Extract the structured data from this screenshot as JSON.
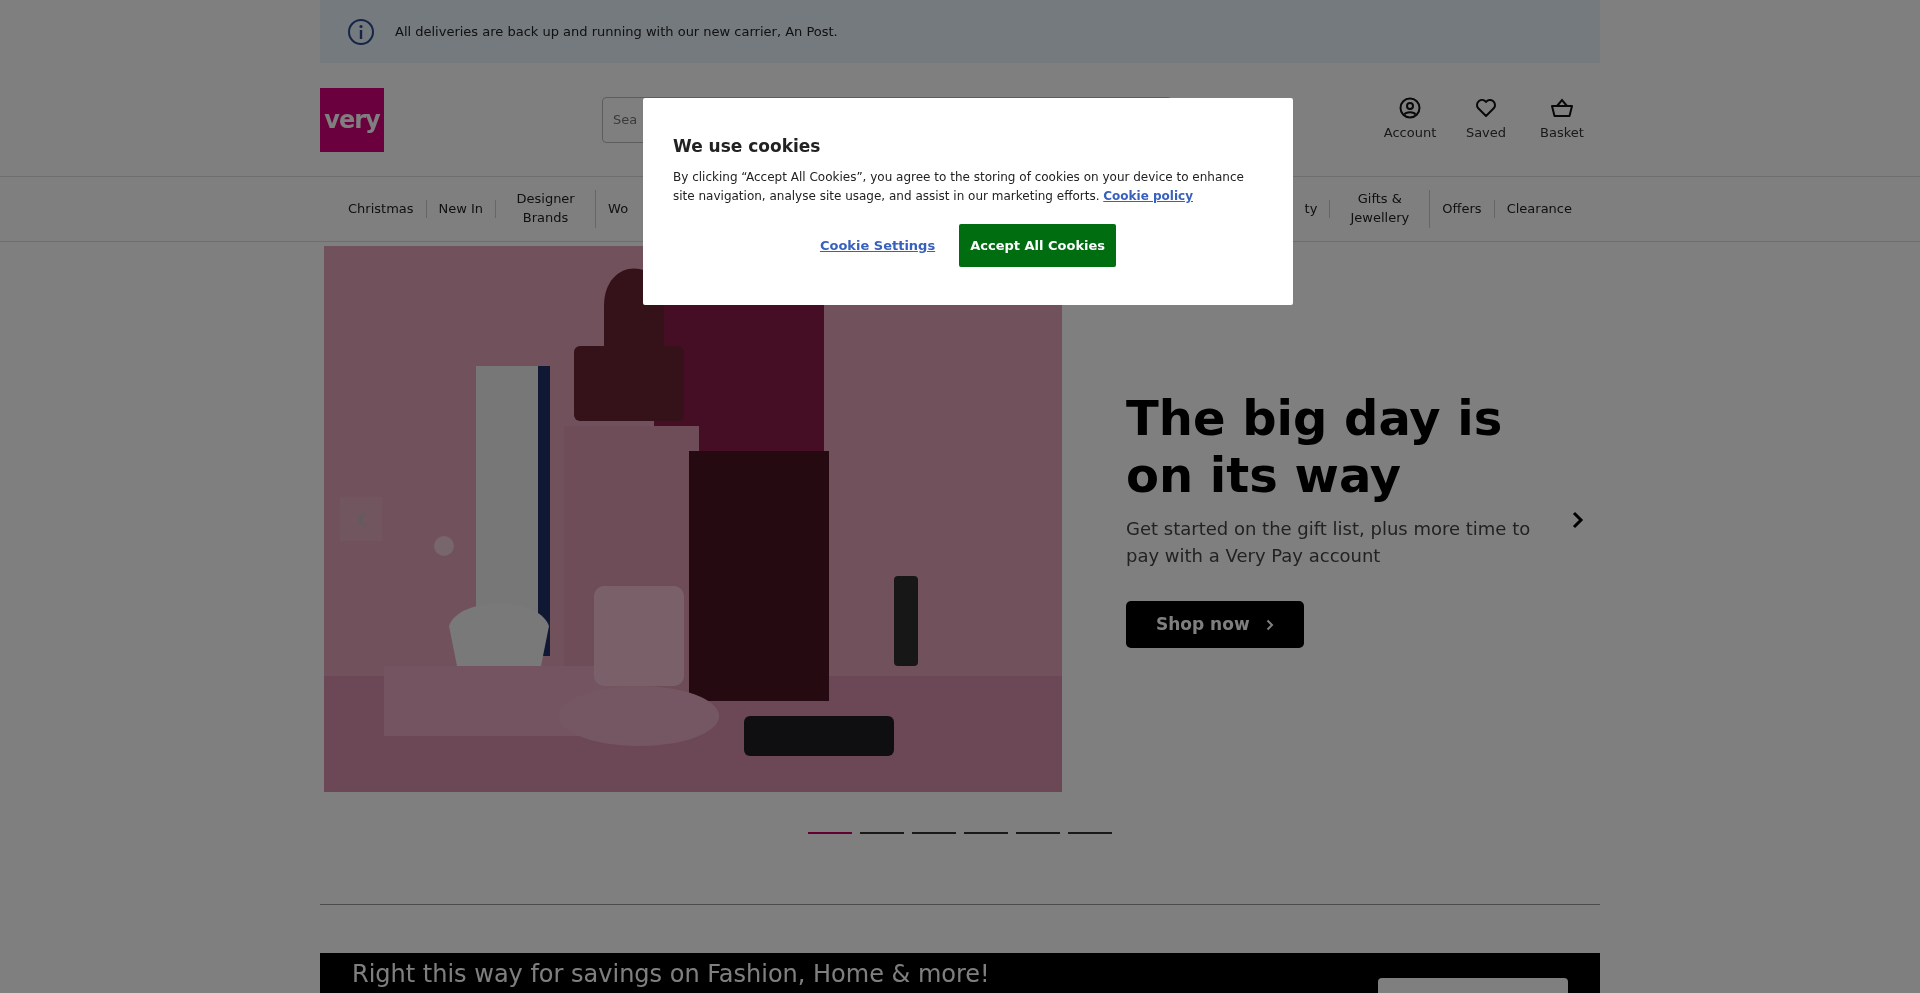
{
  "notice": {
    "text": "All deliveries are back up and running with our new carrier, An Post."
  },
  "header": {
    "logo": "very",
    "search": {
      "placeholder": "Sea"
    },
    "actions": [
      {
        "kind": "account",
        "label": "Account"
      },
      {
        "kind": "saved",
        "label": "Saved"
      },
      {
        "kind": "basket",
        "label": "Basket"
      }
    ]
  },
  "nav_left": [
    "Christmas",
    "New In",
    "Designer Brands",
    "Wo"
  ],
  "nav_right": [
    "ty",
    "Gifts & Jewellery",
    "Offers",
    "Clearance"
  ],
  "hero": {
    "headline": "The big day is on its way",
    "subtitle": "Get started on the gift list, plus more time to pay with a Very Pay account",
    "button": "Shop now"
  },
  "slides": [
    {
      "selected": true
    },
    {
      "selected": false
    },
    {
      "selected": false
    },
    {
      "selected": false
    },
    {
      "selected": false
    },
    {
      "selected": false
    }
  ],
  "promo": {
    "text": "Right this way for savings on Fashion, Home & more!"
  },
  "cookie_dialog": {
    "title": "We use cookies",
    "text": "By clicking “Accept All Cookies”, you agree to the storing of cookies on your device to enhance site navigation, analyse site usage, and assist in our marketing efforts.",
    "link": "Cookie policy",
    "settings_button": "Cookie Settings",
    "accept_button": "Accept All Cookies"
  }
}
